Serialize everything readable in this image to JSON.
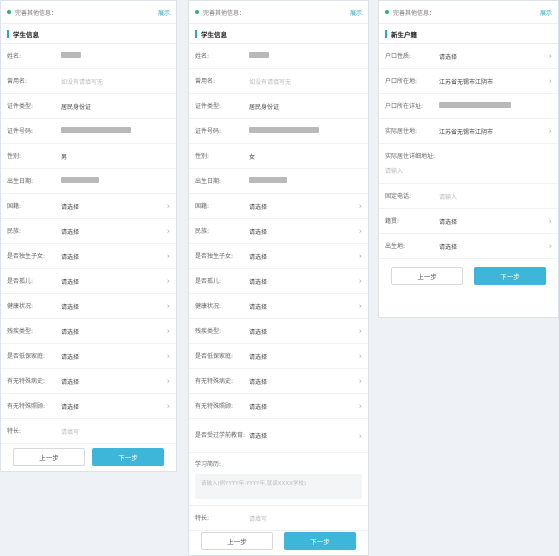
{
  "header": {
    "title": "完善其他信息：",
    "action": "展示"
  },
  "panel1": {
    "section": "学生信息",
    "fields": [
      {
        "label": "姓名:",
        "value": "",
        "blur": 20,
        "chev": false
      },
      {
        "label": "曾用名:",
        "value": "如没有请填写无",
        "ph": true,
        "chev": false
      },
      {
        "label": "证件类型:",
        "value": "居民身份证",
        "chev": false
      },
      {
        "label": "证件号码:",
        "value": "",
        "blur": 70,
        "chev": false
      },
      {
        "label": "性别:",
        "value": "男",
        "chev": false
      },
      {
        "label": "出生日期:",
        "value": "",
        "blur": 38,
        "chev": false
      },
      {
        "label": "国籍:",
        "value": "请选择",
        "chev": true
      },
      {
        "label": "民族:",
        "value": "请选择",
        "chev": true
      },
      {
        "label": "是否独生子女:",
        "value": "请选择",
        "chev": true
      },
      {
        "label": "是否孤儿:",
        "value": "请选择",
        "chev": true
      },
      {
        "label": "健康状况:",
        "value": "请选择",
        "chev": true
      },
      {
        "label": "残疾类型:",
        "value": "请选择",
        "chev": true
      },
      {
        "label": "是否低保家庭:",
        "value": "请选择",
        "chev": true
      },
      {
        "label": "有无特殊病史:",
        "value": "请选择",
        "chev": true
      },
      {
        "label": "有无特殊照顾:",
        "value": "请选择",
        "chev": true
      },
      {
        "label": "特长:",
        "value": "请填写",
        "ph": true,
        "chev": false
      }
    ],
    "prev": "上一步",
    "next": "下一步"
  },
  "panel2": {
    "section": "学生信息",
    "fields": [
      {
        "label": "姓名:",
        "value": "",
        "blur": 20,
        "chev": false
      },
      {
        "label": "曾用名:",
        "value": "如没有请填写无",
        "ph": true,
        "chev": false
      },
      {
        "label": "证件类型:",
        "value": "居民身份证",
        "chev": false
      },
      {
        "label": "证件号码:",
        "value": "",
        "blur": 70,
        "chev": false
      },
      {
        "label": "性别:",
        "value": "女",
        "chev": false
      },
      {
        "label": "出生日期:",
        "value": "",
        "blur": 38,
        "chev": false
      },
      {
        "label": "国籍:",
        "value": "请选择",
        "chev": true
      },
      {
        "label": "民族:",
        "value": "请选择",
        "chev": true
      },
      {
        "label": "是否独生子女:",
        "value": "请选择",
        "chev": true
      },
      {
        "label": "是否孤儿:",
        "value": "请选择",
        "chev": true
      },
      {
        "label": "健康状况:",
        "value": "请选择",
        "chev": true
      },
      {
        "label": "残疾类型:",
        "value": "请选择",
        "chev": true
      },
      {
        "label": "是否低保家庭:",
        "value": "请选择",
        "chev": true
      },
      {
        "label": "有无特殊病史:",
        "value": "请选择",
        "chev": true
      },
      {
        "label": "有无特殊照顾:",
        "value": "请选择",
        "chev": true
      },
      {
        "label": "是否受过学前教育:",
        "value": "请选择",
        "chev": true,
        "tall": true
      }
    ],
    "study_label": "学习简历:",
    "study_placeholder": "请输入(例YYYY年-YYYY年,就读XXXX学校)",
    "special_label": "特长:",
    "special_value": "请填写",
    "prev": "上一步",
    "next": "下一步"
  },
  "panel3": {
    "section": "新生户籍",
    "fields": [
      {
        "label": "户口性质:",
        "value": "请选择",
        "chev": true
      },
      {
        "label": "户口所在地:",
        "value": "江苏省无锡市江阴市",
        "chev": true
      },
      {
        "label": "户口所在详址:",
        "value": "",
        "blur": 72,
        "chev": false
      },
      {
        "label": "实际居住地:",
        "value": "江苏省无锡市江阴市",
        "chev": true
      }
    ],
    "addr_label": "实际居住详细地址:",
    "addr_placeholder": "请输入",
    "fields2": [
      {
        "label": "固定电话:",
        "value": "请输入",
        "ph": true,
        "chev": false
      },
      {
        "label": "籍贯:",
        "value": "请选择",
        "chev": true
      },
      {
        "label": "出生地:",
        "value": "请选择",
        "chev": true
      }
    ],
    "prev": "上一步",
    "next": "下一步"
  },
  "colors": {
    "accent": "#3db6d9",
    "dot": "#2db47d",
    "link": "#29a9c9"
  }
}
